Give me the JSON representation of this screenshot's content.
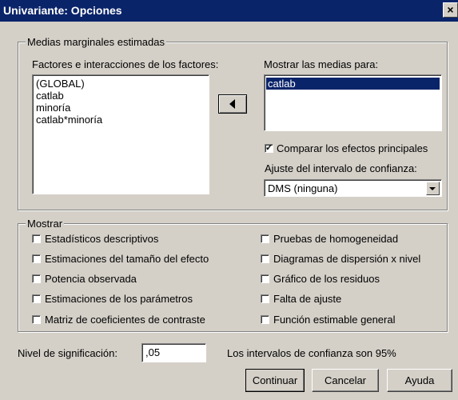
{
  "window": {
    "title": "Univariante: Opciones",
    "close_glyph": "×"
  },
  "emm": {
    "legend": "Medias marginales estimadas",
    "factors_label": "Factores e interacciones de los factores:",
    "factors": [
      "(GLOBAL)",
      "catlab",
      "minoría",
      "catlab*minoría"
    ],
    "move_button_icon": "left-arrow-icon",
    "show_means_label": "Mostrar las medias para:",
    "show_means_items": [
      "catlab"
    ],
    "compare_label": "Comparar los efectos principales",
    "compare_checked": true,
    "ci_adjust_label": "Ajuste del intervalo de confianza:",
    "ci_adjust_value": "DMS (ninguna)"
  },
  "display": {
    "legend": "Mostrar",
    "options_left": [
      {
        "label": "Estadísticos descriptivos",
        "checked": false
      },
      {
        "label": "Estimaciones del tamaño del efecto",
        "checked": false
      },
      {
        "label": "Potencia observada",
        "checked": false
      },
      {
        "label": "Estimaciones de los parámetros",
        "checked": false
      },
      {
        "label": "Matriz de coeficientes de contraste",
        "checked": false
      }
    ],
    "options_right": [
      {
        "label": "Pruebas de homogeneidad",
        "checked": false
      },
      {
        "label": "Diagramas de dispersión x nivel",
        "checked": false
      },
      {
        "label": "Gráfico de los residuos",
        "checked": false
      },
      {
        "label": "Falta de ajuste",
        "checked": false
      },
      {
        "label": "Función estimable general",
        "checked": false
      }
    ]
  },
  "significance": {
    "label": "Nivel de significación:",
    "value": ",05",
    "info": "Los intervalos de confianza son 95%"
  },
  "buttons": {
    "continue": "Continuar",
    "cancel": "Cancelar",
    "help": "Ayuda"
  },
  "colors": {
    "face": "#d4d0c8",
    "titlebar": "#0a246a",
    "selection": "#0a246a"
  }
}
